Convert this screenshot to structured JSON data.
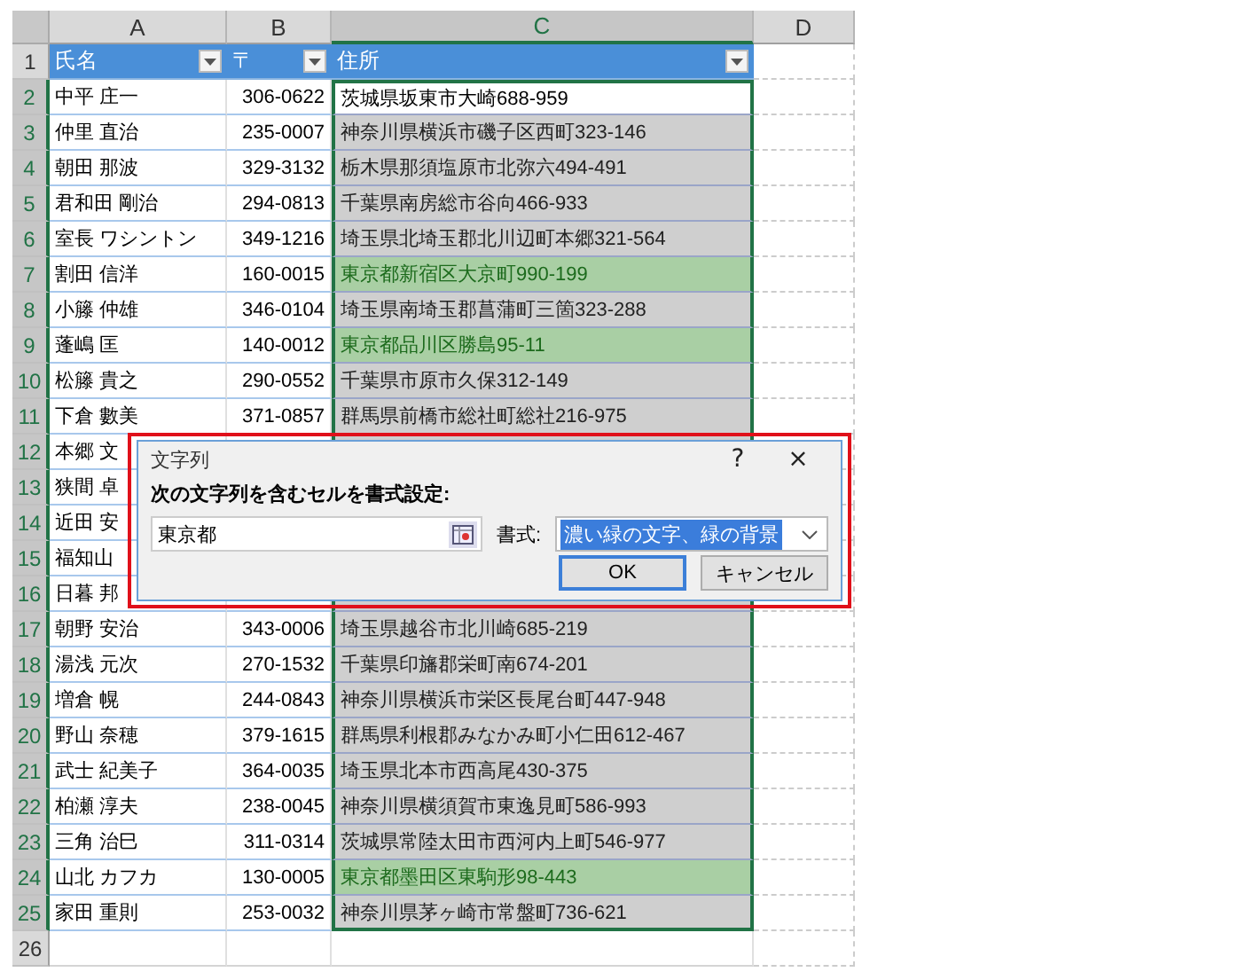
{
  "columns": [
    {
      "label": "A",
      "selected": false
    },
    {
      "label": "B",
      "selected": false
    },
    {
      "label": "C",
      "selected": true
    },
    {
      "label": "D",
      "selected": false
    }
  ],
  "header_row": {
    "number": "1",
    "cells": [
      "氏名",
      "〒",
      "住所"
    ]
  },
  "rows": [
    {
      "kind": "full",
      "number": "2",
      "name": "中平 庄一",
      "zip": "306-0622",
      "address": "茨城県坂東市大崎688-959",
      "match": false,
      "active": true
    },
    {
      "kind": "full",
      "number": "3",
      "name": "仲里 直治",
      "zip": "235-0007",
      "address": "神奈川県横浜市磯子区西町323-146",
      "match": false,
      "active": false
    },
    {
      "kind": "full",
      "number": "4",
      "name": "朝田 那波",
      "zip": "329-3132",
      "address": "栃木県那須塩原市北弥六494-491",
      "match": false,
      "active": false
    },
    {
      "kind": "full",
      "number": "5",
      "name": "君和田 剛治",
      "zip": "294-0813",
      "address": "千葉県南房総市谷向466-933",
      "match": false,
      "active": false
    },
    {
      "kind": "full",
      "number": "6",
      "name": "室長 ワシントン",
      "zip": "349-1216",
      "address": "埼玉県北埼玉郡北川辺町本郷321-564",
      "match": false,
      "active": false
    },
    {
      "kind": "full",
      "number": "7",
      "name": "割田 信洋",
      "zip": "160-0015",
      "address": "東京都新宿区大京町990-199",
      "match": true,
      "active": false
    },
    {
      "kind": "full",
      "number": "8",
      "name": "小籐 仲雄",
      "zip": "346-0104",
      "address": "埼玉県南埼玉郡菖蒲町三箇323-288",
      "match": false,
      "active": false
    },
    {
      "kind": "full",
      "number": "9",
      "name": "蓬嶋 匡",
      "zip": "140-0012",
      "address": "東京都品川区勝島95-11",
      "match": true,
      "active": false
    },
    {
      "kind": "full",
      "number": "10",
      "name": "松籐 貴之",
      "zip": "290-0552",
      "address": "千葉県市原市久保312-149",
      "match": false,
      "active": false
    },
    {
      "kind": "full",
      "number": "11",
      "name": "下倉 數美",
      "zip": "371-0857",
      "address": "群馬県前橋市総社町総社216-975",
      "match": false,
      "active": false
    },
    {
      "kind": "covered",
      "number": "12",
      "name": "本郷 文"
    },
    {
      "kind": "covered",
      "number": "13",
      "name": "狭間 卓"
    },
    {
      "kind": "covered",
      "number": "14",
      "name": "近田 安"
    },
    {
      "kind": "covered",
      "number": "15",
      "name": "福知山"
    },
    {
      "kind": "covered",
      "number": "16",
      "name": "日暮 邦"
    },
    {
      "kind": "full",
      "number": "17",
      "name": "朝野 安治",
      "zip": "343-0006",
      "address": "埼玉県越谷市北川崎685-219",
      "match": false,
      "active": false
    },
    {
      "kind": "full",
      "number": "18",
      "name": "湯浅 元次",
      "zip": "270-1532",
      "address": "千葉県印旛郡栄町南674-201",
      "match": false,
      "active": false
    },
    {
      "kind": "full",
      "number": "19",
      "name": "増倉 幌",
      "zip": "244-0843",
      "address": "神奈川県横浜市栄区長尾台町447-948",
      "match": false,
      "active": false
    },
    {
      "kind": "full",
      "number": "20",
      "name": "野山 奈穂",
      "zip": "379-1615",
      "address": "群馬県利根郡みなかみ町小仁田612-467",
      "match": false,
      "active": false
    },
    {
      "kind": "full",
      "number": "21",
      "name": "武士 紀美子",
      "zip": "364-0035",
      "address": "埼玉県北本市西高尾430-375",
      "match": false,
      "active": false
    },
    {
      "kind": "full",
      "number": "22",
      "name": "柏瀬 淳夫",
      "zip": "238-0045",
      "address": "神奈川県横須賀市東逸見町586-993",
      "match": false,
      "active": false
    },
    {
      "kind": "full",
      "number": "23",
      "name": "三角 治巳",
      "zip": "311-0314",
      "address": "茨城県常陸太田市西河内上町546-977",
      "match": false,
      "active": false
    },
    {
      "kind": "full",
      "number": "24",
      "name": "山北 カフカ",
      "zip": "130-0005",
      "address": "東京都墨田区東駒形98-443",
      "match": true,
      "active": false
    },
    {
      "kind": "full",
      "number": "25",
      "name": "家田 重則",
      "zip": "253-0032",
      "address": "神奈川県茅ヶ崎市常盤町736-621",
      "match": false,
      "active": false
    },
    {
      "kind": "empty",
      "number": "26"
    }
  ],
  "dialog": {
    "title": "文字列",
    "help": "?",
    "close": "×",
    "prompt": "次の文字列を含むセルを書式設定:",
    "value": "東京都",
    "format_label": "書式:",
    "format_value": "濃い緑の文字、緑の背景",
    "ok": "OK",
    "cancel": "キャンセル"
  }
}
